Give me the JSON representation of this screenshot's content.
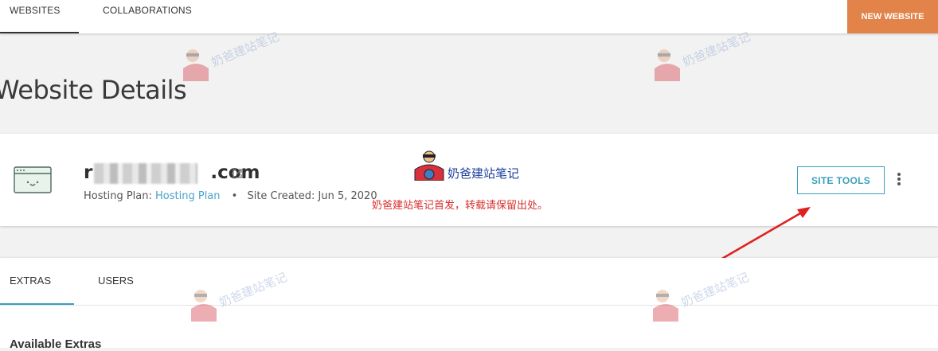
{
  "topnav": {
    "tabs": [
      "WEBSITES",
      "COLLABORATIONS"
    ],
    "active_tab": "WEBSITES",
    "new_website_label": "NEW WEBSITE"
  },
  "page": {
    "title": "Website Details"
  },
  "site_card": {
    "domain_visible_prefix": "r",
    "domain_visible_suffix": ".com",
    "hosting_plan_label": "Hosting Plan:",
    "hosting_plan_link": "Hosting Plan",
    "site_created_label": "Site Created:",
    "site_created_date": "Jun 5, 2020",
    "site_tools_label": "SITE TOOLS"
  },
  "watermark": {
    "logo_text": "奶爸建站笔记",
    "notice": "奶爸建站笔记首发，转载请保留出处。"
  },
  "detail_tabs": {
    "tabs": [
      "EXTRAS",
      "USERS"
    ],
    "active_tab": "EXTRAS",
    "section_heading": "Available Extras"
  },
  "colors": {
    "accent": "#3aa0bd",
    "new_website_bg": "#e2834a",
    "notice_text": "#d82f2f",
    "arrow": "#e02020"
  },
  "icons": [
    "site-browser-icon",
    "external-link-icon",
    "more-vertical-icon"
  ]
}
